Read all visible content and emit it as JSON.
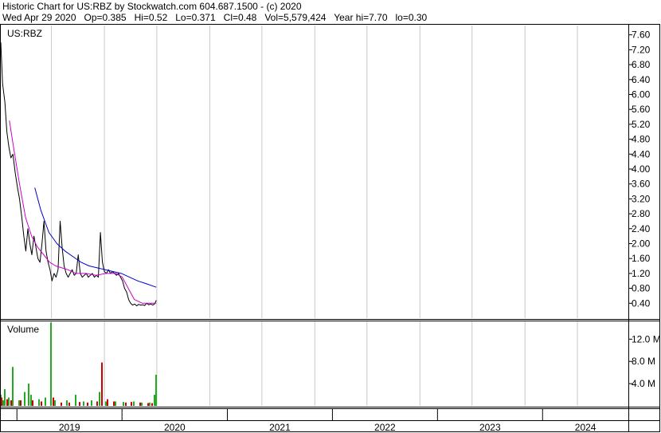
{
  "header": {
    "line1": "Historic Chart for US:RBZ by Stockwatch.com 604.687.1500 - (c) 2020",
    "line2": "Wed Apr 29 2020   Op=0.385   Hi=0.52   Lo=0.371   Cl=0.48   Vol=5,579,424   Year hi=7.70   lo=0.30"
  },
  "chart_data": {
    "type": "line",
    "symbol_label": "US:RBZ",
    "volume_label": "Volume",
    "price_axis": {
      "ticks": [
        0.4,
        0.8,
        1.2,
        1.6,
        2.0,
        2.4,
        2.8,
        3.2,
        3.6,
        4.0,
        4.4,
        4.8,
        5.2,
        5.6,
        6.0,
        6.4,
        6.8,
        7.2,
        7.6
      ],
      "tick_labels": [
        "0.40",
        "0.80",
        "1.20",
        "1.60",
        "2.00",
        "2.40",
        "2.80",
        "3.20",
        "3.60",
        "4.00",
        "4.40",
        "4.80",
        "5.20",
        "5.60",
        "6.00",
        "6.40",
        "6.80",
        "7.20",
        "7.60"
      ],
      "ylim": [
        0.0,
        7.85
      ]
    },
    "volume_axis": {
      "ticks": [
        4.0,
        8.0,
        12.0
      ],
      "tick_labels": [
        "4.0 M",
        "8.0 M",
        "12.0 M"
      ],
      "unit": "M",
      "ylim": [
        0,
        15.2
      ]
    },
    "x_axis": {
      "year_labels": [
        "2019",
        "2020",
        "2021",
        "2022",
        "2023",
        "2024"
      ],
      "xlim": [
        "2018-11-06",
        "2024-10-25"
      ],
      "gridlines": [
        "2019-05-01",
        "2019-11-01",
        "2020-05-01",
        "2020-11-01",
        "2021-05-01",
        "2021-11-01",
        "2022-05-01",
        "2022-11-01",
        "2023-05-01",
        "2023-11-01",
        "2024-05-01"
      ],
      "year_boundaries": [
        "2019-01-01",
        "2020-01-01",
        "2021-01-01",
        "2022-01-01",
        "2023-01-01",
        "2024-01-01"
      ]
    },
    "grid": true,
    "series": [
      {
        "color": "#000000",
        "values": [
          [
            "2018-11-06",
            7.4
          ],
          [
            "2018-11-12",
            6.3
          ],
          [
            "2018-11-20",
            5.8
          ],
          [
            "2018-11-27",
            5.0
          ],
          [
            "2018-12-04",
            4.6
          ],
          [
            "2018-12-11",
            4.3
          ],
          [
            "2018-12-18",
            4.4
          ],
          [
            "2018-12-26",
            3.9
          ],
          [
            "2019-01-03",
            3.5
          ],
          [
            "2019-01-10",
            3.2
          ],
          [
            "2019-01-18",
            2.7
          ],
          [
            "2019-01-25",
            2.2
          ],
          [
            "2019-02-01",
            1.8
          ],
          [
            "2019-02-08",
            2.4
          ],
          [
            "2019-02-15",
            2.0
          ],
          [
            "2019-02-22",
            1.7
          ],
          [
            "2019-03-01",
            2.2
          ],
          [
            "2019-03-08",
            1.9
          ],
          [
            "2019-03-15",
            1.6
          ],
          [
            "2019-03-22",
            1.5
          ],
          [
            "2019-03-29",
            2.0
          ],
          [
            "2019-04-05",
            2.6
          ],
          [
            "2019-04-12",
            1.8
          ],
          [
            "2019-04-19",
            1.5
          ],
          [
            "2019-04-26",
            1.3
          ],
          [
            "2019-05-03",
            1.0
          ],
          [
            "2019-05-10",
            1.2
          ],
          [
            "2019-05-17",
            1.1
          ],
          [
            "2019-05-24",
            1.3
          ],
          [
            "2019-05-31",
            2.6
          ],
          [
            "2019-06-07",
            1.9
          ],
          [
            "2019-06-14",
            1.4
          ],
          [
            "2019-06-21",
            1.2
          ],
          [
            "2019-06-28",
            1.1
          ],
          [
            "2019-07-05",
            1.2
          ],
          [
            "2019-07-12",
            1.3
          ],
          [
            "2019-07-19",
            1.15
          ],
          [
            "2019-07-26",
            1.2
          ],
          [
            "2019-08-02",
            1.7
          ],
          [
            "2019-08-09",
            1.2
          ],
          [
            "2019-08-16",
            1.1
          ],
          [
            "2019-08-23",
            1.15
          ],
          [
            "2019-08-30",
            1.2
          ],
          [
            "2019-09-06",
            1.1
          ],
          [
            "2019-09-13",
            1.15
          ],
          [
            "2019-09-20",
            1.2
          ],
          [
            "2019-09-27",
            1.1
          ],
          [
            "2019-10-04",
            1.15
          ],
          [
            "2019-10-11",
            1.1
          ],
          [
            "2019-10-18",
            2.3
          ],
          [
            "2019-10-25",
            1.5
          ],
          [
            "2019-11-01",
            1.25
          ],
          [
            "2019-11-08",
            1.2
          ],
          [
            "2019-11-15",
            1.3
          ],
          [
            "2019-11-22",
            1.2
          ],
          [
            "2019-11-29",
            1.25
          ],
          [
            "2019-12-06",
            1.2
          ],
          [
            "2019-12-13",
            1.15
          ],
          [
            "2019-12-20",
            1.2
          ],
          [
            "2019-12-27",
            1.1
          ],
          [
            "2020-01-03",
            1.0
          ],
          [
            "2020-01-10",
            0.8
          ],
          [
            "2020-01-17",
            0.7
          ],
          [
            "2020-01-24",
            0.5
          ],
          [
            "2020-01-31",
            0.4
          ],
          [
            "2020-02-07",
            0.35
          ],
          [
            "2020-02-14",
            0.38
          ],
          [
            "2020-02-21",
            0.33
          ],
          [
            "2020-02-28",
            0.37
          ],
          [
            "2020-03-06",
            0.35
          ],
          [
            "2020-03-13",
            0.36
          ],
          [
            "2020-03-20",
            0.34
          ],
          [
            "2020-03-27",
            0.4
          ],
          [
            "2020-04-03",
            0.36
          ],
          [
            "2020-04-10",
            0.38
          ],
          [
            "2020-04-17",
            0.35
          ],
          [
            "2020-04-24",
            0.39
          ],
          [
            "2020-04-29",
            0.48
          ]
        ]
      },
      {
        "color": "#cc00cc",
        "values": [
          [
            "2018-12-06",
            5.3
          ],
          [
            "2018-12-20",
            4.6
          ],
          [
            "2019-01-10",
            3.6
          ],
          [
            "2019-01-31",
            2.7
          ],
          [
            "2019-02-21",
            2.2
          ],
          [
            "2019-03-14",
            1.9
          ],
          [
            "2019-04-04",
            1.7
          ],
          [
            "2019-04-25",
            1.5
          ],
          [
            "2019-05-16",
            1.4
          ],
          [
            "2019-06-06",
            1.35
          ],
          [
            "2019-06-27",
            1.3
          ],
          [
            "2019-07-25",
            1.2
          ],
          [
            "2019-08-29",
            1.2
          ],
          [
            "2019-10-03",
            1.15
          ],
          [
            "2019-11-07",
            1.2
          ],
          [
            "2019-12-12",
            1.2
          ],
          [
            "2020-01-02",
            1.1
          ],
          [
            "2020-01-23",
            0.8
          ],
          [
            "2020-02-13",
            0.5
          ],
          [
            "2020-03-12",
            0.4
          ],
          [
            "2020-04-29",
            0.4
          ]
        ]
      },
      {
        "color": "#0000cc",
        "values": [
          [
            "2019-03-04",
            3.5
          ],
          [
            "2019-03-25",
            2.9
          ],
          [
            "2019-04-22",
            2.3
          ],
          [
            "2019-05-20",
            2.0
          ],
          [
            "2019-06-17",
            1.8
          ],
          [
            "2019-07-15",
            1.65
          ],
          [
            "2019-08-12",
            1.5
          ],
          [
            "2019-09-09",
            1.4
          ],
          [
            "2019-10-07",
            1.35
          ],
          [
            "2019-11-04",
            1.3
          ],
          [
            "2019-12-02",
            1.25
          ],
          [
            "2019-12-30",
            1.2
          ],
          [
            "2020-01-27",
            1.1
          ],
          [
            "2020-02-24",
            1.0
          ],
          [
            "2020-03-23",
            0.93
          ],
          [
            "2020-04-29",
            0.83
          ]
        ]
      }
    ],
    "volume": {
      "green": [
        [
          "2018-11-06",
          2.0
        ],
        [
          "2018-11-13",
          1.0
        ],
        [
          "2018-11-20",
          3.0
        ],
        [
          "2018-12-04",
          1.5
        ],
        [
          "2018-12-18",
          7.0
        ],
        [
          "2019-01-08",
          1.0
        ],
        [
          "2019-01-29",
          2.5
        ],
        [
          "2019-02-12",
          4.0
        ],
        [
          "2019-02-19",
          2.0
        ],
        [
          "2019-03-19",
          1.2
        ],
        [
          "2019-04-09",
          1.5
        ],
        [
          "2019-04-30",
          15.0
        ],
        [
          "2019-05-14",
          1.0
        ],
        [
          "2019-06-25",
          1.0
        ],
        [
          "2019-07-23",
          2.0
        ],
        [
          "2019-08-20",
          0.8
        ],
        [
          "2019-09-17",
          1.0
        ],
        [
          "2019-10-15",
          2.5
        ],
        [
          "2019-11-05",
          0.8
        ],
        [
          "2019-12-10",
          0.8
        ],
        [
          "2020-01-07",
          0.7
        ],
        [
          "2020-02-11",
          0.8
        ],
        [
          "2020-03-10",
          0.6
        ],
        [
          "2020-04-07",
          0.6
        ],
        [
          "2020-04-22",
          2.0
        ],
        [
          "2020-04-29",
          5.6
        ]
      ],
      "red": [
        [
          "2018-11-08",
          1.5
        ],
        [
          "2018-11-27",
          1.2
        ],
        [
          "2018-12-11",
          1.0
        ],
        [
          "2019-01-15",
          1.0
        ],
        [
          "2019-02-26",
          1.0
        ],
        [
          "2019-03-26",
          0.8
        ],
        [
          "2019-05-07",
          1.5
        ],
        [
          "2019-06-04",
          0.6
        ],
        [
          "2019-07-02",
          0.6
        ],
        [
          "2019-08-06",
          0.7
        ],
        [
          "2019-09-03",
          0.6
        ],
        [
          "2019-10-08",
          0.8
        ],
        [
          "2019-10-22",
          7.8
        ],
        [
          "2019-11-12",
          1.2
        ],
        [
          "2019-12-03",
          0.8
        ],
        [
          "2020-01-14",
          0.6
        ],
        [
          "2020-02-04",
          0.7
        ],
        [
          "2020-03-03",
          0.6
        ],
        [
          "2020-03-31",
          0.5
        ],
        [
          "2020-04-14",
          0.5
        ]
      ]
    }
  },
  "colors": {
    "price": "#000000",
    "ma_short": "#cc00cc",
    "ma_long": "#0000cc",
    "volume_up": "#22aa22",
    "volume_down": "#cc0000",
    "grid": "#c8c8c8",
    "frame": "#000000"
  }
}
